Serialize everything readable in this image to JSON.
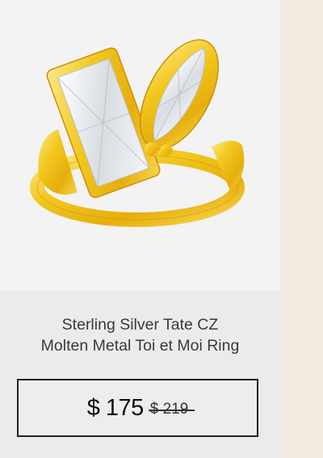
{
  "product": {
    "title_line1": "Sterling Silver Tate CZ",
    "title_line2": "Molten Metal Toi et Moi Ring",
    "price_current": "$ 175",
    "price_original": "$ 219"
  },
  "colors": {
    "page_background": "#f2e9df",
    "card_background": "#ebebeb",
    "gold": "#f0c51c",
    "border": "#222222"
  }
}
